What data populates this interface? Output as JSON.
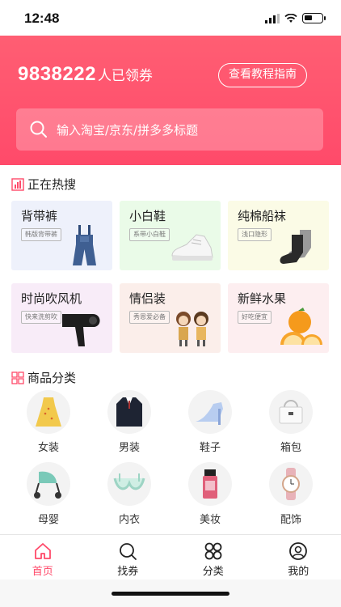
{
  "status": {
    "time": "12:48"
  },
  "header": {
    "coupon_count": "9838222",
    "coupon_suffix": "人已领券",
    "guide_button": "查看教程指南",
    "search_placeholder": "输入淘宝/京东/拼多多标题"
  },
  "hot": {
    "title": "正在热搜",
    "items": [
      {
        "name": "背带裤",
        "tag": "韩版背带裤",
        "bg": "#eef1fb"
      },
      {
        "name": "小白鞋",
        "tag": "系带小白鞋",
        "bg": "#eafbe8"
      },
      {
        "name": "纯棉船袜",
        "tag": "浅口隐形",
        "bg": "#fbfbe6"
      },
      {
        "name": "时尚吹风机",
        "tag": "快来洗剪吹",
        "bg": "#f8ecf8"
      },
      {
        "name": "情侣装",
        "tag": "秀恩爱必备",
        "bg": "#fbeeea"
      },
      {
        "name": "新鲜水果",
        "tag": "好吃便宜",
        "bg": "#fdeef0"
      }
    ]
  },
  "categories": {
    "title": "商品分类",
    "items": [
      {
        "label": "女装"
      },
      {
        "label": "男装"
      },
      {
        "label": "鞋子"
      },
      {
        "label": "箱包"
      },
      {
        "label": "母婴"
      },
      {
        "label": "内衣"
      },
      {
        "label": "美妆"
      },
      {
        "label": "配饰"
      }
    ]
  },
  "tabs": [
    {
      "label": "首页",
      "active": true
    },
    {
      "label": "找券"
    },
    {
      "label": "分类"
    },
    {
      "label": "我的"
    }
  ],
  "colors": {
    "accent": "#ff4a6a"
  }
}
